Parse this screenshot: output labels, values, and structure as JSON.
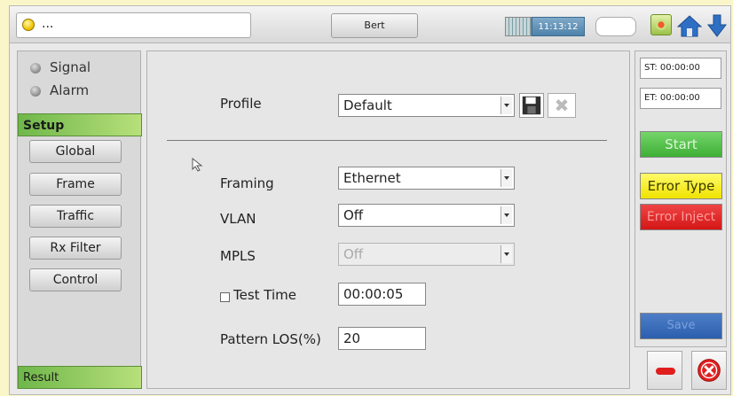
{
  "topbar": {
    "status_text": "...",
    "bert_label": "Bert",
    "clock": "11:13:12"
  },
  "left_panel": {
    "indicators": [
      {
        "label": "Signal"
      },
      {
        "label": "Alarm"
      }
    ],
    "setup_header": "Setup",
    "nav_items": [
      {
        "label": "Global"
      },
      {
        "label": "Frame"
      },
      {
        "label": "Traffic"
      },
      {
        "label": "Rx Filter"
      },
      {
        "label": "Control"
      }
    ],
    "result_header": "Result"
  },
  "main": {
    "profile_label": "Profile",
    "profile_value": "Default",
    "framing_label": "Framing",
    "framing_value": "Ethernet",
    "vlan_label": "VLAN",
    "vlan_value": "Off",
    "mpls_label": "MPLS",
    "mpls_value": "Off",
    "test_time_label": "Test Time",
    "test_time_value": "00:00:05",
    "test_time_checked": false,
    "pattern_los_label": "Pattern LOS(%)",
    "pattern_los_value": "20"
  },
  "right_panel": {
    "start_time": "ST: 00:00:00",
    "elapsed_time": "ET: 00:00:00",
    "start_label": "Start",
    "error_type_label": "Error Type",
    "error_inject_label": "Error Inject",
    "save_label": "Save"
  },
  "colors": {
    "accent_green": "#4ab33f",
    "error_yellow": "#f5e900",
    "error_red": "#e02020",
    "save_blue": "#3466b5",
    "header_green": "#6fb74a",
    "background": "#fbf6c9"
  },
  "icons": [
    "status-led-icon",
    "grid-icon",
    "system-icon",
    "home-icon",
    "down-arrow-icon",
    "save-icon",
    "delete-icon",
    "cursor-icon",
    "minus-icon",
    "close-icon"
  ]
}
